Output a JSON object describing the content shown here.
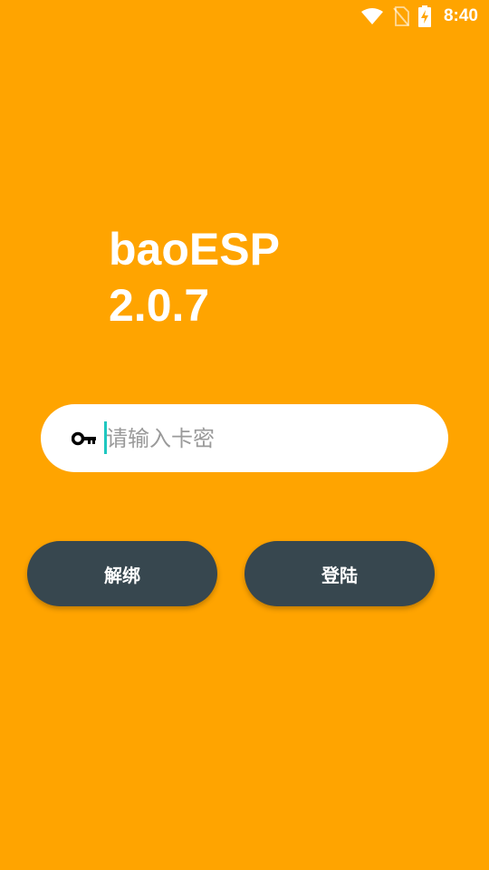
{
  "status_bar": {
    "time": "8:40",
    "icons": [
      "wifi-icon",
      "no-sim-icon",
      "battery-charging-icon"
    ]
  },
  "app": {
    "name": "baoESP",
    "version": "2.0.7"
  },
  "login": {
    "key_icon": "key-icon",
    "card_input_placeholder": "请输入卡密",
    "card_input_value": "",
    "unbind_label": "解绑",
    "login_label": "登陆"
  },
  "colors": {
    "background": "#FFA400",
    "button": "#37474F",
    "input_background": "#FFFFFF",
    "cursor": "#1FC7C0"
  }
}
